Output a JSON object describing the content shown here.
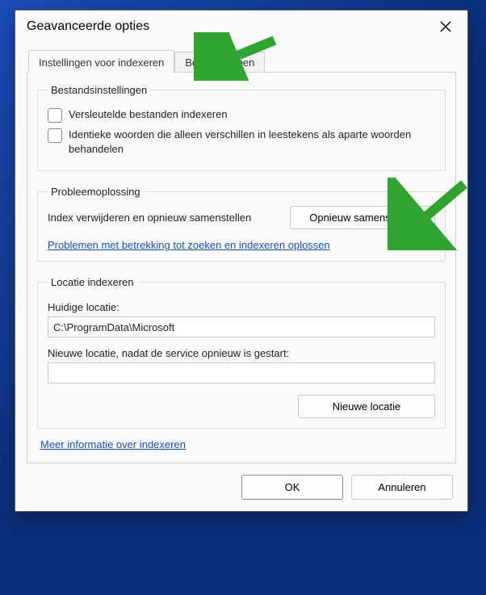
{
  "dialog": {
    "title": "Geavanceerde opties",
    "tabs": [
      {
        "label": "Instellingen voor indexeren"
      },
      {
        "label": "Bestandstypen"
      }
    ],
    "file_settings": {
      "legend": "Bestandsinstellingen",
      "encrypt_label": "Versleutelde bestanden indexeren",
      "diacritics_label": "Identieke woorden die alleen verschillen in leestekens als aparte woorden behandelen"
    },
    "troubleshoot": {
      "legend": "Probleemoplossing",
      "rebuild_desc": "Index verwijderen en opnieuw samenstellen",
      "rebuild_button": "Opnieuw samenstellen",
      "troubleshoot_link": "Problemen met betrekking tot zoeken en indexeren oplossen"
    },
    "location": {
      "legend": "Locatie indexeren",
      "current_label": "Huidige locatie:",
      "current_value": "C:\\ProgramData\\Microsoft",
      "new_label": "Nieuwe locatie, nadat de service opnieuw is gestart:",
      "new_value": "",
      "new_button": "Nieuwe locatie"
    },
    "more_info_link": "Meer informatie over indexeren",
    "ok_label": "OK",
    "cancel_label": "Annuleren"
  },
  "annotation": {
    "arrow_color": "#2fa52f"
  }
}
